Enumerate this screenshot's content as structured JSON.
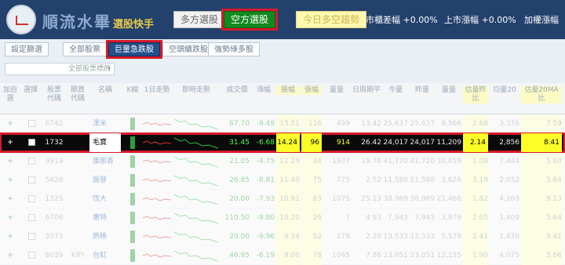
{
  "header": {
    "brand": "順流水畢",
    "brand_sub": "選股快手",
    "tab_long": "多方選股",
    "tab_short": "空方選股",
    "today": "今日多空趨勢",
    "stat1_label": "市櫃差幅",
    "stat1_value": "+0.00%",
    "stat2_label": "上市漲幅",
    "stat2_value": "+0.00%",
    "stat3_label": "加權漲幅"
  },
  "filters": {
    "settings": "設定篩選",
    "all": "全部股票",
    "big_volume": "巨量急跌股",
    "empty_continue": "空頭續跌股",
    "strong_bear": "強勢綠多股",
    "group_select": "全部股票標的"
  },
  "columns": [
    "加自選",
    "選擇",
    "股票代碼",
    "期貨代碼",
    "名稱",
    "K線",
    "1日走勢",
    "即時走勢",
    "成交價",
    "漲幅",
    "振幅",
    "張幅",
    "量量",
    "日周期平",
    "今量",
    "昨量",
    "量量",
    "估量昨比",
    "均量20",
    "估量20MA比"
  ],
  "rows": [
    {
      "code": "6742",
      "fut": "",
      "name": "澤米",
      "price": "67.70",
      "chg": "-9.49",
      "amp": "15.51",
      "z": "116",
      "vol": "499",
      "d": "13.42",
      "today": "25,637",
      "y1": "25,637",
      "y2": "9,566",
      "r1": "2.68",
      "avg": "3,376",
      "r2": "7.59"
    },
    {
      "code": "1732",
      "fut": "",
      "name": "毛寶",
      "price": "31.45",
      "chg": "-6.68",
      "amp": "14.24",
      "z": "96",
      "vol": "914",
      "d": "26.42",
      "today": "24,017",
      "y1": "24,017",
      "y2": "11,209",
      "r1": "2.14",
      "avg": "2,856",
      "r2": "8.41"
    },
    {
      "code": "9919",
      "fut": "",
      "name": "康那香",
      "price": "21.05",
      "chg": "-4.75",
      "amp": "12.29",
      "z": "34",
      "vol": "1937",
      "d": "19.78",
      "today": "41,720",
      "y1": "41,720",
      "y2": "38,659",
      "r1": "1.08",
      "avg": "7,444",
      "r2": "5.60"
    },
    {
      "code": "5426",
      "fut": "",
      "name": "振發",
      "price": "26.85",
      "chg": "-8.81",
      "amp": "11.40",
      "z": "75",
      "vol": "775",
      "d": "2.52",
      "today": "11,580",
      "y1": "11,580",
      "y2": "3,626",
      "r1": "3.19",
      "avg": "2,052",
      "r2": "5.64"
    },
    {
      "code": "1325",
      "fut": "",
      "name": "恆大",
      "price": "20.00",
      "chg": "-7.93",
      "amp": "10.81",
      "z": "83",
      "vol": "1075",
      "d": "25.13",
      "today": "38,969",
      "y1": "38,969",
      "y2": "21,466",
      "r1": "1.82",
      "avg": "4,269",
      "r2": "9.13"
    },
    {
      "code": "6706",
      "fut": "",
      "name": "惠特",
      "price": "110.50",
      "chg": "-9.80",
      "amp": "10.20",
      "z": "26",
      "vol": "7",
      "d": "4.93",
      "today": "7,943",
      "y1": "7,943",
      "y2": "3,879",
      "r1": "2.05",
      "avg": "1,409",
      "r2": "5.64"
    },
    {
      "code": "3373",
      "fut": "",
      "name": "熱映",
      "price": "20.00",
      "chg": "-9.96",
      "amp": "9.34",
      "z": "52",
      "vol": "278",
      "d": "2.29",
      "today": "13,533",
      "y1": "13,533",
      "y2": "5,579",
      "r1": "2.41",
      "avg": "1,470",
      "r2": "9.41"
    },
    {
      "code": "8039",
      "fut": "KIFI",
      "name": "台虹",
      "price": "46.95",
      "chg": "-6.19",
      "amp": "9.00",
      "z": "78",
      "vol": "1045",
      "d": "7.86",
      "today": "23,051",
      "y1": "23,051",
      "y2": "12,155",
      "r1": "1.90",
      "avg": "4,075",
      "r2": "5.66"
    }
  ],
  "colors": {
    "accent_red": "#d6192c",
    "short_green": "#118a1e",
    "nav_blue": "#23416d",
    "highlight_yellow": "#fbff27"
  }
}
